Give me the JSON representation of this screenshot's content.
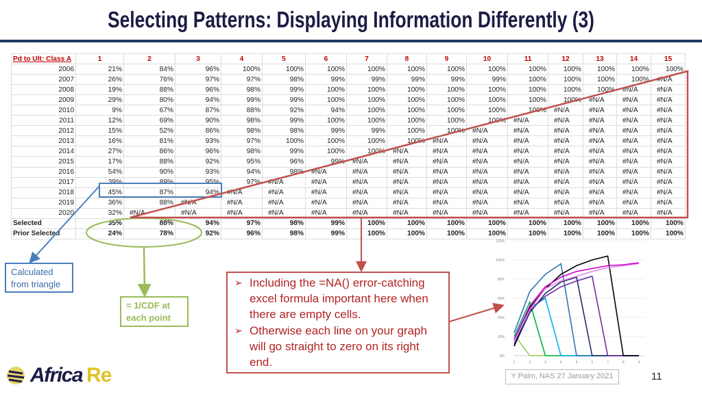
{
  "title": "Selecting Patterns: Displaying Information Differently (3)",
  "table": {
    "corner": "Pd to Ult: Class A",
    "columns": [
      "1",
      "2",
      "3",
      "4",
      "5",
      "6",
      "7",
      "8",
      "9",
      "10",
      "11",
      "12",
      "13",
      "14",
      "15"
    ],
    "rows": [
      {
        "label": "2006",
        "values": [
          "21%",
          "84%",
          "96%",
          "100%",
          "100%",
          "100%",
          "100%",
          "100%",
          "100%",
          "100%",
          "100%",
          "100%",
          "100%",
          "100%",
          "100%"
        ]
      },
      {
        "label": "2007",
        "values": [
          "26%",
          "76%",
          "97%",
          "97%",
          "98%",
          "99%",
          "99%",
          "99%",
          "99%",
          "99%",
          "100%",
          "100%",
          "100%",
          "100%",
          "#N/A"
        ]
      },
      {
        "label": "2008",
        "values": [
          "19%",
          "88%",
          "96%",
          "98%",
          "99%",
          "100%",
          "100%",
          "100%",
          "100%",
          "100%",
          "100%",
          "100%",
          "100%",
          "#N/A",
          "#N/A"
        ]
      },
      {
        "label": "2009",
        "values": [
          "29%",
          "80%",
          "94%",
          "99%",
          "99%",
          "100%",
          "100%",
          "100%",
          "100%",
          "100%",
          "100%",
          "100%",
          "#N/A",
          "#N/A",
          "#N/A"
        ]
      },
      {
        "label": "2010",
        "values": [
          "9%",
          "67%",
          "87%",
          "88%",
          "92%",
          "94%",
          "100%",
          "100%",
          "100%",
          "100%",
          "100%",
          "#N/A",
          "#N/A",
          "#N/A",
          "#N/A"
        ]
      },
      {
        "label": "2011",
        "values": [
          "12%",
          "69%",
          "90%",
          "98%",
          "99%",
          "100%",
          "100%",
          "100%",
          "100%",
          "100%",
          "#N/A",
          "#N/A",
          "#N/A",
          "#N/A",
          "#N/A"
        ]
      },
      {
        "label": "2012",
        "values": [
          "15%",
          "52%",
          "86%",
          "98%",
          "98%",
          "99%",
          "99%",
          "100%",
          "100%",
          "#N/A",
          "#N/A",
          "#N/A",
          "#N/A",
          "#N/A",
          "#N/A"
        ]
      },
      {
        "label": "2013",
        "values": [
          "16%",
          "81%",
          "93%",
          "97%",
          "100%",
          "100%",
          "100%",
          "100%",
          "#N/A",
          "#N/A",
          "#N/A",
          "#N/A",
          "#N/A",
          "#N/A",
          "#N/A"
        ]
      },
      {
        "label": "2014",
        "values": [
          "27%",
          "86%",
          "96%",
          "98%",
          "99%",
          "100%",
          "100%",
          "#N/A",
          "#N/A",
          "#N/A",
          "#N/A",
          "#N/A",
          "#N/A",
          "#N/A",
          "#N/A"
        ]
      },
      {
        "label": "2015",
        "values": [
          "17%",
          "88%",
          "92%",
          "95%",
          "96%",
          "99%",
          "#N/A",
          "#N/A",
          "#N/A",
          "#N/A",
          "#N/A",
          "#N/A",
          "#N/A",
          "#N/A",
          "#N/A"
        ]
      },
      {
        "label": "2016",
        "values": [
          "54%",
          "90%",
          "93%",
          "94%",
          "98%",
          "#N/A",
          "#N/A",
          "#N/A",
          "#N/A",
          "#N/A",
          "#N/A",
          "#N/A",
          "#N/A",
          "#N/A",
          "#N/A"
        ]
      },
      {
        "label": "2017",
        "values": [
          "39%",
          "89%",
          "95%",
          "97%",
          "#N/A",
          "#N/A",
          "#N/A",
          "#N/A",
          "#N/A",
          "#N/A",
          "#N/A",
          "#N/A",
          "#N/A",
          "#N/A",
          "#N/A"
        ]
      },
      {
        "label": "2018",
        "values": [
          "45%",
          "87%",
          "94%",
          "#N/A",
          "#N/A",
          "#N/A",
          "#N/A",
          "#N/A",
          "#N/A",
          "#N/A",
          "#N/A",
          "#N/A",
          "#N/A",
          "#N/A",
          "#N/A"
        ]
      },
      {
        "label": "2019",
        "values": [
          "36%",
          "88%",
          "#N/A",
          "#N/A",
          "#N/A",
          "#N/A",
          "#N/A",
          "#N/A",
          "#N/A",
          "#N/A",
          "#N/A",
          "#N/A",
          "#N/A",
          "#N/A",
          "#N/A"
        ]
      },
      {
        "label": "2020",
        "values": [
          "32%",
          "#N/A",
          "#N/A",
          "#N/A",
          "#N/A",
          "#N/A",
          "#N/A",
          "#N/A",
          "#N/A",
          "#N/A",
          "#N/A",
          "#N/A",
          "#N/A",
          "#N/A",
          "#N/A"
        ]
      }
    ],
    "summary": [
      {
        "label": "Selected",
        "values": [
          "35%",
          "88%",
          "94%",
          "97%",
          "98%",
          "99%",
          "100%",
          "100%",
          "100%",
          "100%",
          "100%",
          "100%",
          "100%",
          "100%",
          "100%"
        ]
      },
      {
        "label": "Prior Selected",
        "values": [
          "24%",
          "78%",
          "92%",
          "96%",
          "98%",
          "99%",
          "100%",
          "100%",
          "100%",
          "100%",
          "100%",
          "100%",
          "100%",
          "100%",
          "100%"
        ]
      }
    ]
  },
  "annotations": {
    "calculated": "Calculated from triangle",
    "cdf": "= 1/CDF at each point",
    "notes": [
      "Including the =NA() error-catching excel formula important here when there are empty cells.",
      "Otherwise each line on your graph will go straight to zero on its right end."
    ],
    "bullet": "➢"
  },
  "chart_data": {
    "type": "line",
    "x": [
      1,
      2,
      3,
      4,
      5,
      6,
      7,
      8,
      9
    ],
    "xticks": [
      "1",
      "2",
      "3",
      "4",
      "5",
      "6",
      "7",
      "8",
      "9"
    ],
    "yticks": [
      "0%",
      "20%",
      "40%",
      "60%",
      "80%",
      "100%",
      "120%"
    ],
    "ylim": [
      0,
      120
    ],
    "grid": true,
    "series": [
      {
        "color": "#92d050",
        "values": [
          22,
          0,
          0,
          0,
          0,
          0,
          0,
          0,
          0
        ]
      },
      {
        "color": "#00b050",
        "values": [
          20,
          56,
          0,
          0,
          0,
          0,
          0,
          0,
          0
        ]
      },
      {
        "color": "#00b0f0",
        "values": [
          15,
          50,
          60,
          0,
          0,
          0,
          0,
          0,
          0
        ]
      },
      {
        "color": "#2e75b6",
        "values": [
          24,
          67,
          85,
          96,
          0,
          0,
          0,
          0,
          0
        ]
      },
      {
        "color": "#1f2d6b",
        "values": [
          10,
          45,
          65,
          77,
          82,
          0,
          0,
          0,
          0
        ]
      },
      {
        "color": "#7030a0",
        "values": [
          12,
          47,
          62,
          72,
          78,
          83,
          0,
          0,
          0
        ]
      },
      {
        "color": "#000000",
        "values": [
          10,
          50,
          70,
          85,
          94,
          100,
          104,
          0,
          0
        ]
      },
      {
        "color": "#e58ee8",
        "values": [
          14,
          48,
          70,
          78,
          83,
          88,
          92,
          94,
          96
        ]
      },
      {
        "color": "#cc00cc",
        "values": [
          17,
          52,
          72,
          82,
          88,
          91,
          94,
          95,
          97
        ]
      }
    ]
  },
  "footer": "Y Palm, NAS 27 January 2021",
  "page_number": "11",
  "logo": {
    "text1": "Africa",
    "text2": "Re"
  }
}
